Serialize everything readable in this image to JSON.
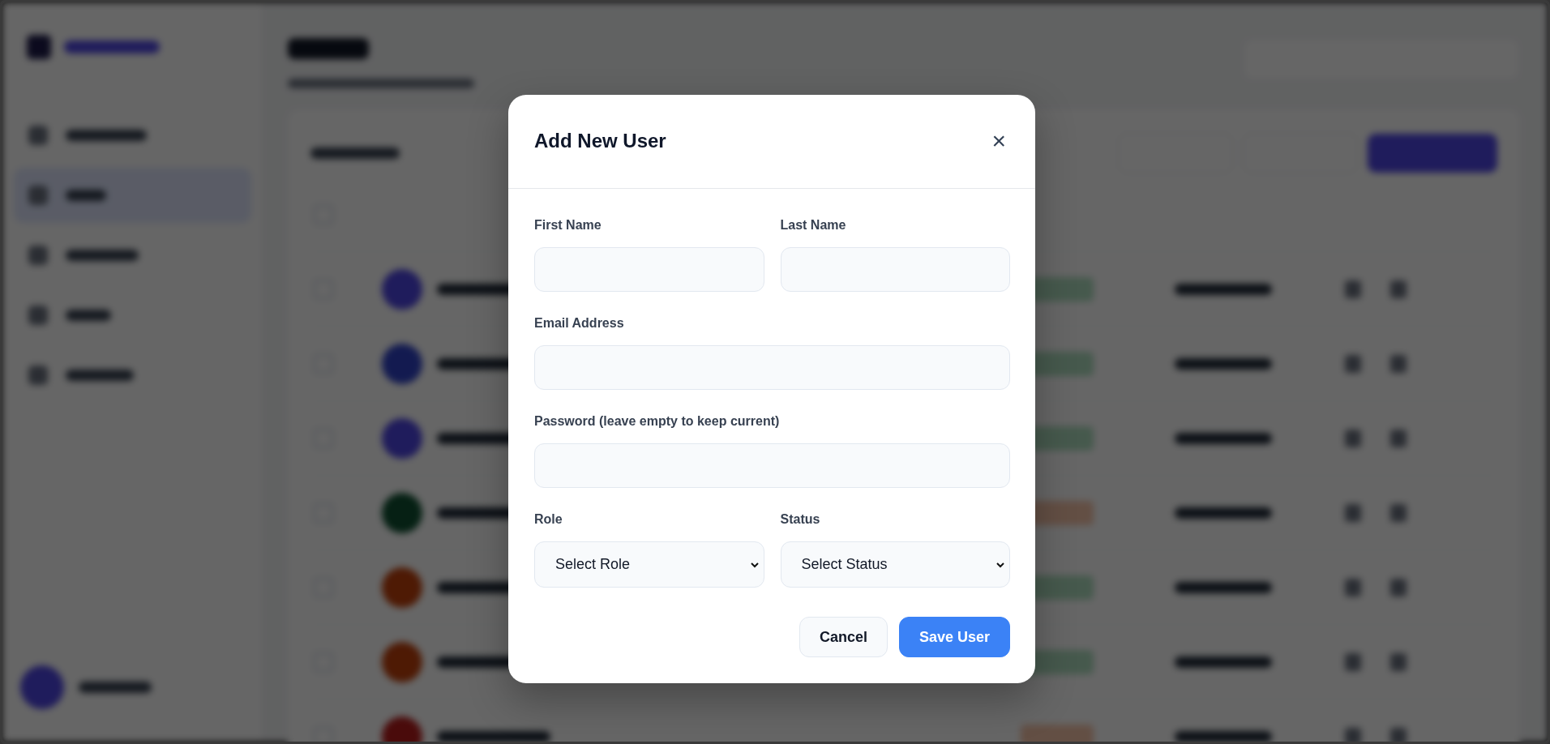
{
  "dialog": {
    "title": "Add New User",
    "close_label": "×",
    "rows": [
      [
        {
          "kind": "text",
          "label": "First Name"
        },
        {
          "kind": "text",
          "label": "Last Name"
        }
      ],
      [
        {
          "kind": "text",
          "label": "Email Address"
        }
      ],
      [
        {
          "kind": "text",
          "label": "Password (leave empty to keep current)"
        }
      ],
      [
        {
          "kind": "select",
          "label": "Role",
          "value": "Select Role"
        },
        {
          "kind": "select",
          "label": "Status",
          "value": "Select Status"
        }
      ]
    ],
    "buttons": [
      {
        "kind": "secondary",
        "label": "Cancel"
      },
      {
        "kind": "primary",
        "label": "Save User"
      }
    ]
  }
}
